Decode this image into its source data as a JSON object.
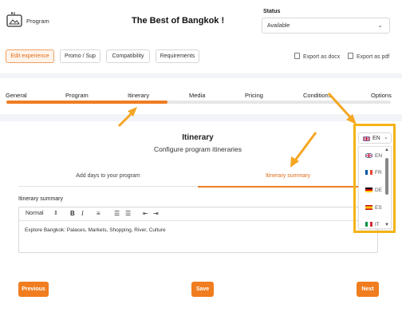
{
  "header": {
    "program_label": "Program",
    "title": "The Best of Bangkok !",
    "status_label": "Status",
    "status_value": "Available"
  },
  "top_tabs": [
    {
      "label": "Edit experience",
      "active": true
    },
    {
      "label": "Promo / Sup",
      "active": false
    },
    {
      "label": "Compatibility",
      "active": false
    },
    {
      "label": "Requirements",
      "active": false
    }
  ],
  "exports": {
    "docx": "Export as docx",
    "pdf": "Export as pdf"
  },
  "steps": [
    "General",
    "Program",
    "Itinerary",
    "Media",
    "Pricing",
    "Conditions",
    "Options"
  ],
  "step_progress_percent": 42,
  "section": {
    "title": "Itinerary",
    "subtitle": "Configure program itineraries"
  },
  "subtabs": {
    "add_days": "Add days to your program",
    "summary": "Itinerary summary"
  },
  "editor": {
    "label": "Itinerary summary",
    "format": "Normal",
    "content": "Explore Bangkok: Palaces, Markets, Shopping, River, Culture"
  },
  "buttons": {
    "previous": "Previous",
    "save": "Save",
    "next": "Next"
  },
  "language": {
    "current": "EN",
    "options": [
      "EN",
      "FR",
      "DE",
      "ES",
      "IT"
    ]
  },
  "colors": {
    "accent": "#ef7d22",
    "highlight": "#f5b316"
  }
}
